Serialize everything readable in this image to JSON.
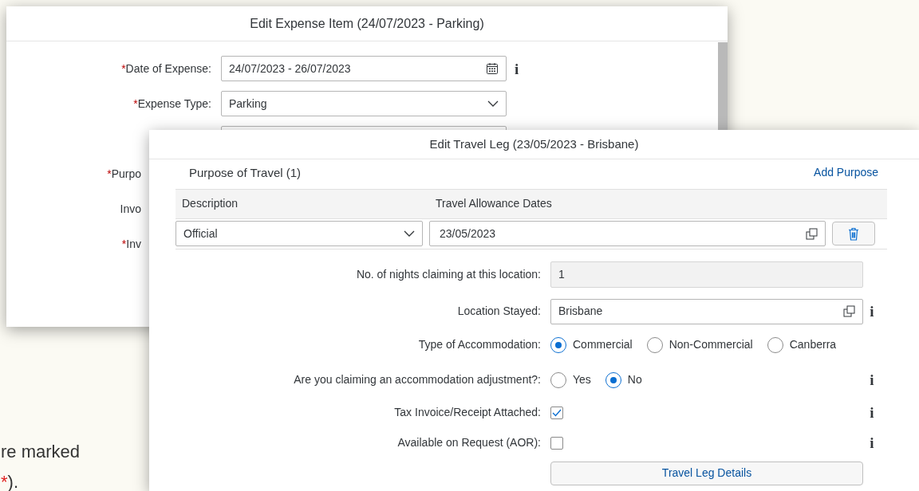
{
  "footnote": {
    "lines": [
      {
        "text": "re marked"
      },
      {
        "marker": "*",
        "text": ")."
      }
    ]
  },
  "expense_dialog": {
    "title": "Edit Expense Item (24/07/2023 - Parking)",
    "fields": [
      {
        "kind": "date",
        "label": "Date of Expense:",
        "required": true,
        "value": "24/07/2023 - 26/07/2023",
        "info": "i"
      },
      {
        "kind": "select",
        "label": "Expense Type:",
        "required": true,
        "value": "Parking"
      },
      {
        "kind": "input"
      },
      {
        "kind": "covered",
        "label": "Purpo",
        "required": true
      },
      {
        "kind": "covered",
        "label": "Invo",
        "required": false
      },
      {
        "kind": "covered",
        "label": "Inv",
        "required": true
      }
    ]
  },
  "travel_leg_dialog": {
    "title": "Edit Travel Leg (23/05/2023 - Brisbane)",
    "section": {
      "title": "Purpose of Travel (1)",
      "action": "Add Purpose"
    },
    "table": {
      "columns": [
        "Description",
        "Travel Allowance Dates"
      ],
      "rows": [
        {
          "description": "Official",
          "dates": "23/05/2023"
        }
      ]
    },
    "form": [
      {
        "kind": "readonly",
        "label": "No. of nights claiming at this location:",
        "value": "1"
      },
      {
        "kind": "valuehelp",
        "label": "Location Stayed:",
        "value": "Brisbane",
        "info": "i"
      },
      {
        "kind": "radio",
        "label": "Type of Accommodation:",
        "options": [
          {
            "label": "Commercial",
            "selected": true
          },
          {
            "label": "Non-Commercial",
            "selected": false
          },
          {
            "label": "Canberra",
            "selected": false
          }
        ]
      },
      {
        "kind": "radio",
        "label": "Are you claiming an accommodation adjustment?:",
        "info": "i",
        "options": [
          {
            "label": "Yes",
            "selected": false
          },
          {
            "label": "No",
            "selected": true
          }
        ]
      },
      {
        "kind": "checkbox",
        "label": "Tax Invoice/Receipt Attached:",
        "checked": true,
        "info": "i"
      },
      {
        "kind": "checkbox",
        "label": "Available on Request (AOR):",
        "checked": false,
        "info": "i"
      },
      {
        "kind": "button",
        "label": "Travel Leg Details"
      }
    ]
  }
}
